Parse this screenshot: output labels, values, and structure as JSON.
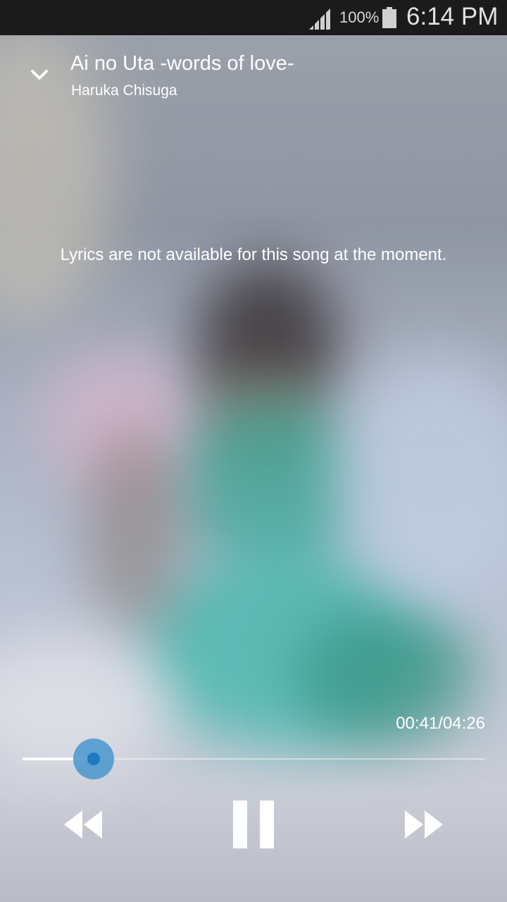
{
  "status_bar": {
    "battery_percent": "100%",
    "time": "6:14 PM",
    "signal_icon": "signal-strength-icon",
    "battery_icon": "battery-full-icon"
  },
  "header": {
    "collapse_icon": "chevron-down-icon",
    "title": "Ai no Uta -words of love-",
    "artist": "Haruka Chisuga"
  },
  "lyrics": {
    "message": "Lyrics are not available for this song at the moment."
  },
  "playback": {
    "time_display": "00:41/04:26",
    "elapsed_seconds": 41,
    "total_seconds": 266,
    "progress_fraction": 0.154
  },
  "controls": {
    "rewind_icon": "rewind-icon",
    "pause_icon": "pause-icon",
    "forward_icon": "fast-forward-icon"
  },
  "colors": {
    "accent": "#1f79bd",
    "status_bar_bg": "#1b1b1b",
    "text": "#ffffff"
  }
}
